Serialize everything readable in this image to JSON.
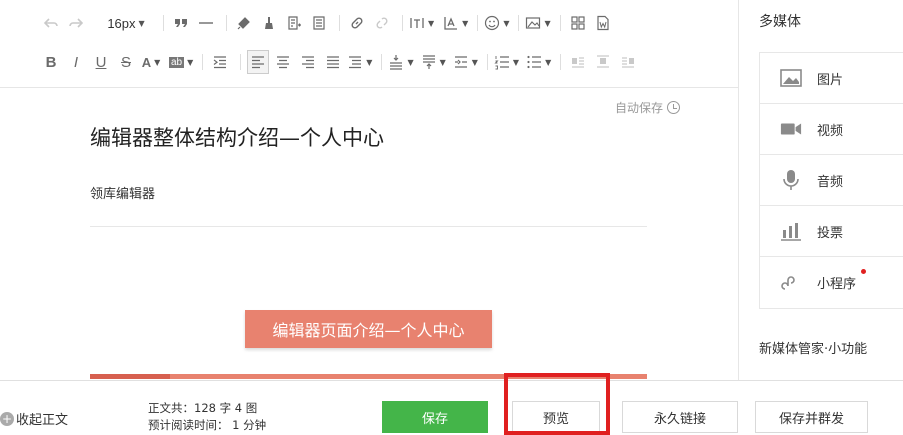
{
  "toolbar": {
    "font_size": "16px",
    "row1": [
      "undo-icon",
      "redo-icon",
      "font-size-select",
      "blockquote-icon",
      "horizontal-rule-icon",
      "format-painter-icon",
      "clear-format-icon",
      "insert-template-icon",
      "paste-text-icon",
      "link-icon",
      "unlink-icon",
      "letter-spacing-icon",
      "line-height-icon",
      "emoji-icon",
      "image-icon",
      "layout-icon",
      "word-import-icon"
    ],
    "row2": [
      "bold",
      "italic",
      "underline",
      "strikethrough",
      "font-color",
      "background-color",
      "indent",
      "align-left",
      "align-center",
      "align-right",
      "align-justify",
      "paragraph-spacing",
      "spacing-before",
      "spacing-after",
      "line-indent",
      "ordered-list",
      "unordered-list",
      "float-left",
      "float-none",
      "float-right"
    ],
    "bold": "B",
    "italic": "I",
    "underline": "U",
    "strike": "S",
    "font_color": "A",
    "bg_color": "ab"
  },
  "editor": {
    "autosave": "自动保存",
    "title": "编辑器整体结构介绍—个人中心",
    "author": "领库编辑器",
    "banner": "编辑器页面介绍—个人中心",
    "colors": {
      "accent": "#e8826f"
    }
  },
  "sidebar": {
    "title": "多媒体",
    "items": [
      {
        "label": "图片",
        "icon": "image-icon"
      },
      {
        "label": "视频",
        "icon": "video-icon"
      },
      {
        "label": "音频",
        "icon": "microphone-icon"
      },
      {
        "label": "投票",
        "icon": "poll-icon"
      },
      {
        "label": "小程序",
        "icon": "mini-program-icon",
        "badge": true
      }
    ],
    "subtitle": "新媒体管家·小功能"
  },
  "bottom": {
    "collapse": "收起正文",
    "stats_line1": "正文共：128 字 4 图",
    "stats_line2": "预计阅读时间： 1 分钟",
    "save": "保存",
    "preview": "预览",
    "permalink": "永久链接",
    "save_and_send": "保存并群发",
    "colors": {
      "primary": "#44b549",
      "highlight": "#e02020"
    }
  }
}
